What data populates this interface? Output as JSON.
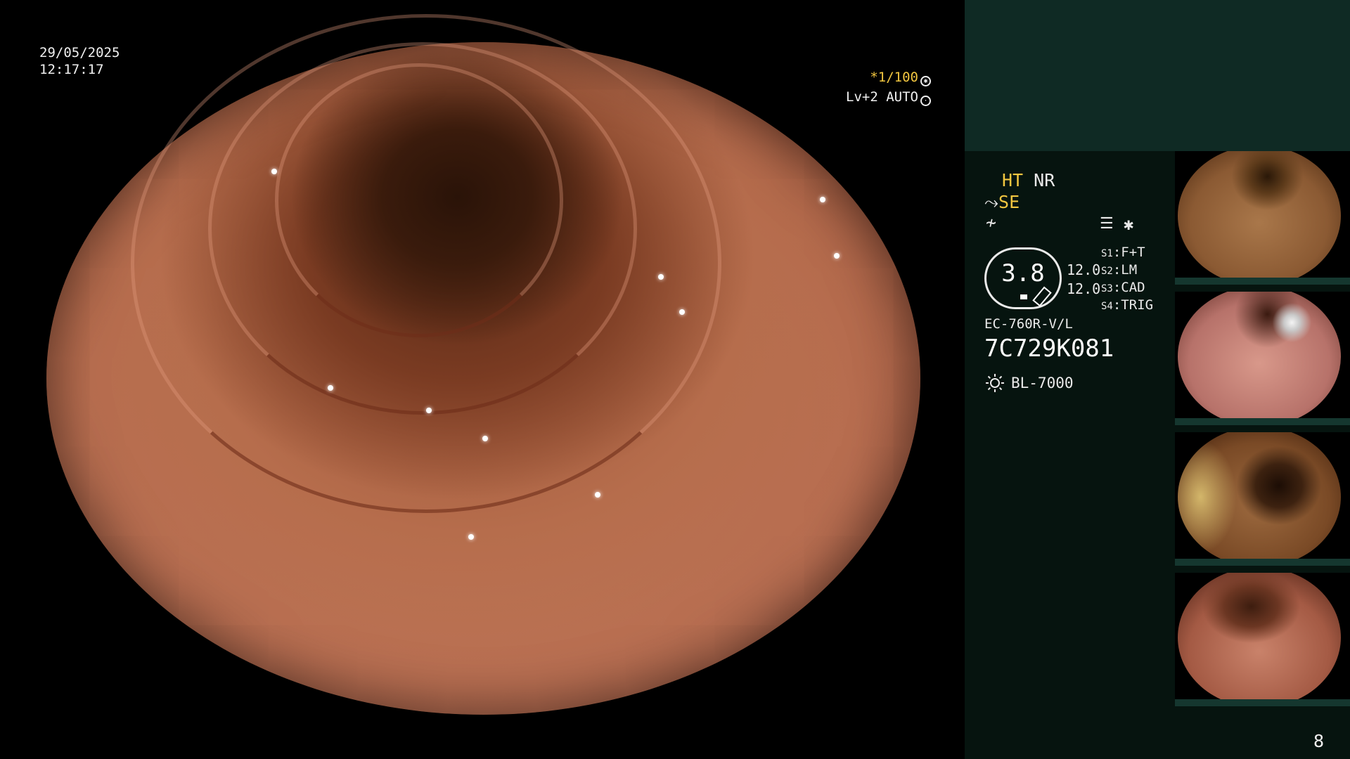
{
  "overlay": {
    "date": "29/05/2025",
    "time": "12:17:17",
    "shutter": "*1/100",
    "level": "Lv+2 AUTO"
  },
  "panel": {
    "ht": "HT",
    "nr": "NR",
    "se": "SE",
    "gauge_value": "3.8",
    "value_a": "12.0",
    "value_b": "12.0",
    "s1_key": "S1",
    "s1_value": ":F+T",
    "s2_key": "S2",
    "s2_value": ":LM",
    "s3_key": "S3",
    "s3_value": ":CAD",
    "s4_key": "S4",
    "s4_value": ":TRIG",
    "model": "EC-760R-V/L",
    "serial": "7C729K081",
    "light_source": "BL-7000"
  },
  "page_number": "8",
  "icons": [
    "aperture-icon",
    "auto-icon",
    "scope-icon",
    "tilde-icon",
    "menu-icon",
    "star-icon",
    "sun-icon"
  ],
  "colors": {
    "accent_yellow": "#f2c640",
    "panel_bg": "#06140f",
    "panel_top": "#0f2a24"
  }
}
